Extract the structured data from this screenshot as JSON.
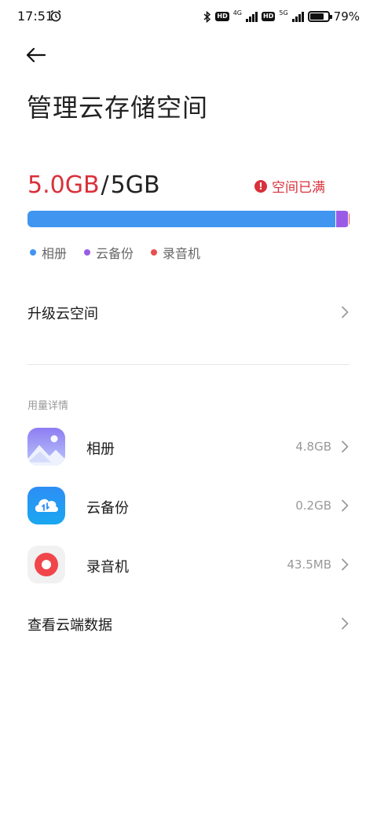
{
  "status_bar": {
    "time": "17:51",
    "hd1": "HD",
    "net1": "4G",
    "hd2": "HD",
    "net2": "5G",
    "battery_percent": "79%",
    "battery_level": 0.79
  },
  "header": {
    "back_icon": "arrow-left-icon",
    "title": "管理云存储空间"
  },
  "storage": {
    "used": "5.0GB",
    "separator": "/",
    "total": "5GB",
    "status_text": "空间已满",
    "status_color": "#d9303a",
    "segments": [
      {
        "name": "相册",
        "fraction": 0.955,
        "color": "#3f95f0"
      },
      {
        "name": "云备份",
        "fraction": 0.04,
        "color": "#9a5ce6"
      },
      {
        "name": "录音机",
        "fraction": 0.005,
        "color": "#e8504d"
      }
    ],
    "legend": [
      {
        "label": "相册",
        "color": "#3f95f0"
      },
      {
        "label": "云备份",
        "color": "#9a5ce6"
      },
      {
        "label": "录音机",
        "color": "#e8504d"
      }
    ]
  },
  "upgrade": {
    "label": "升级云空间"
  },
  "usage_details": {
    "section_title": "用量详情",
    "apps": [
      {
        "name": "相册",
        "size": "4.8GB",
        "icon": "gallery-icon"
      },
      {
        "name": "云备份",
        "size": "0.2GB",
        "icon": "cloud-backup-icon"
      },
      {
        "name": "录音机",
        "size": "43.5MB",
        "icon": "recorder-icon"
      }
    ]
  },
  "view_data": {
    "label": "查看云端数据"
  }
}
